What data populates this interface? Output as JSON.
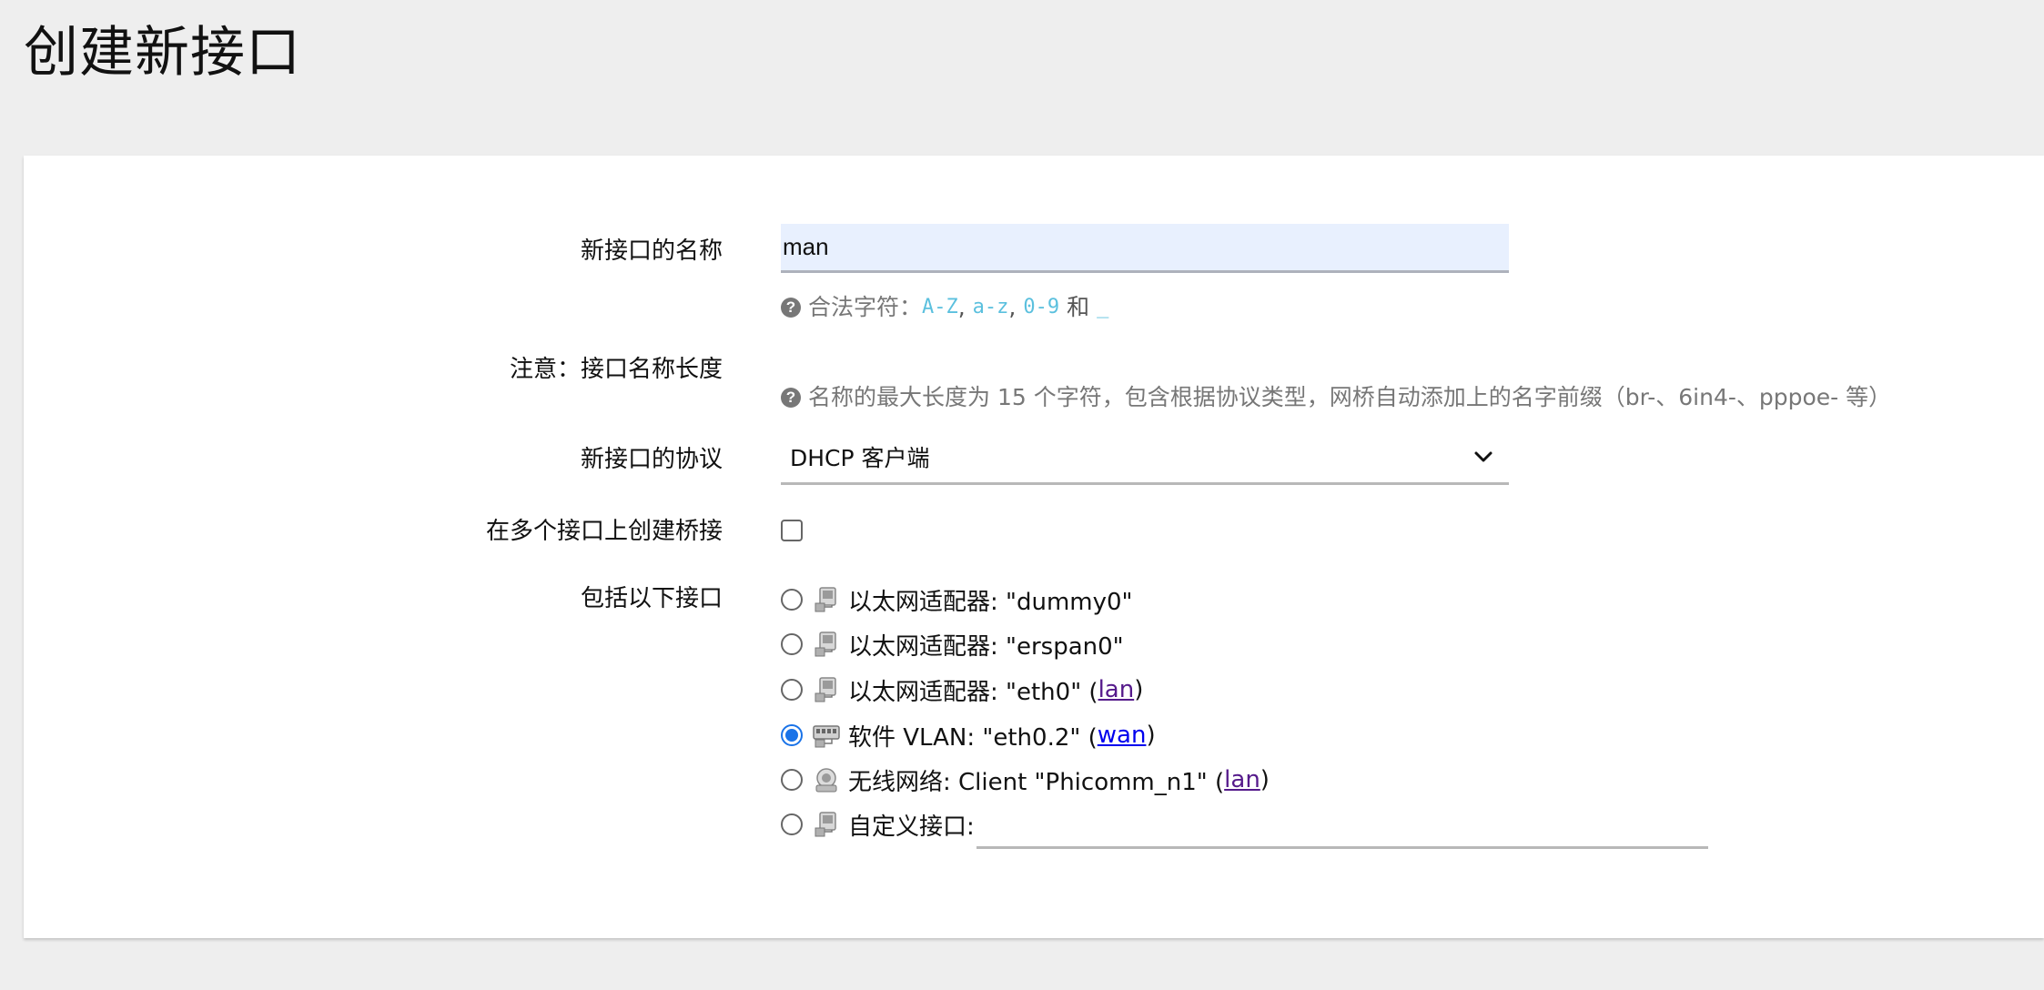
{
  "page": {
    "title": "创建新接口"
  },
  "form": {
    "name": {
      "label": "新接口的名称",
      "value": "man",
      "hint_prefix": "合法字符：",
      "hint_chars": [
        "A-Z",
        "a-z",
        "0-9"
      ],
      "hint_and": "和",
      "hint_underscore": "_"
    },
    "note": {
      "label": "注意：接口名称长度",
      "hint": "名称的最大长度为 15 个字符，包含根据协议类型，网桥自动添加上的名字前缀（br-、6in4-、pppoe- 等）"
    },
    "protocol": {
      "label": "新接口的协议",
      "selected": "DHCP 客户端"
    },
    "bridge": {
      "label": "在多个接口上创建桥接",
      "checked": false
    },
    "interfaces": {
      "label": "包括以下接口",
      "items": [
        {
          "text": "以太网适配器: \"dummy0\"",
          "link": "",
          "selected": false,
          "icon": "ethernet-icon"
        },
        {
          "text": "以太网适配器: \"erspan0\"",
          "link": "",
          "selected": false,
          "icon": "ethernet-icon"
        },
        {
          "text": "以太网适配器: \"eth0\" (",
          "link": "lan",
          "suffix": ")",
          "selected": false,
          "icon": "ethernet-icon"
        },
        {
          "text": "软件 VLAN: \"eth0.2\" (",
          "link": "wan",
          "suffix": ")",
          "selected": true,
          "icon": "vlan-switch-icon"
        },
        {
          "text": "无线网络: Client \"Phicomm_n1\" (",
          "link": "lan",
          "suffix": ")",
          "selected": false,
          "icon": "wireless-icon"
        },
        {
          "text": "自定义接口:",
          "link": "",
          "selected": false,
          "icon": "ethernet-icon"
        }
      ]
    }
  },
  "colors": {
    "input_bg": "#e8f0fe",
    "radio_selected": "#1a73e8",
    "hint_code": "#5bc0de",
    "link_visited": "#551a8b",
    "link": "#0000ee"
  }
}
